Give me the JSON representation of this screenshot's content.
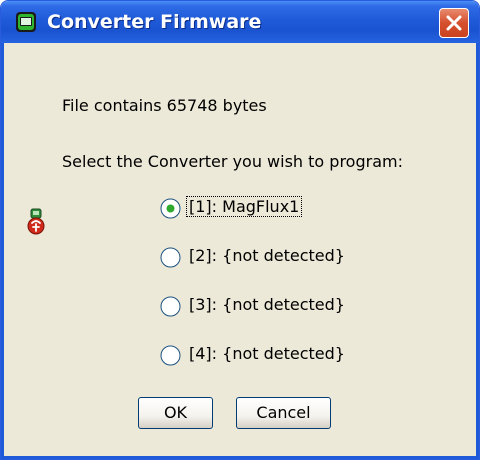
{
  "window": {
    "title": "Converter Firmware",
    "title_icon": "converter-app-icon",
    "close_icon": "close-x-icon"
  },
  "dialog": {
    "file_info": "File contains 65748 bytes",
    "prompt": "Select the Converter you wish to program:",
    "side_icon": "converter-device-icon",
    "options": [
      {
        "label": "[1]: MagFlux1",
        "selected": true
      },
      {
        "label": "[2]: {not detected}",
        "selected": false
      },
      {
        "label": "[3]: {not detected}",
        "selected": false
      },
      {
        "label": "[4]: {not detected}",
        "selected": false
      }
    ]
  },
  "buttons": {
    "ok": "OK",
    "cancel": "Cancel"
  },
  "colors": {
    "titlebar": "#1f5ad8",
    "dialog_background": "#ece9d8",
    "close_button": "#d6502e",
    "radio_selected": "#2faa2f"
  }
}
